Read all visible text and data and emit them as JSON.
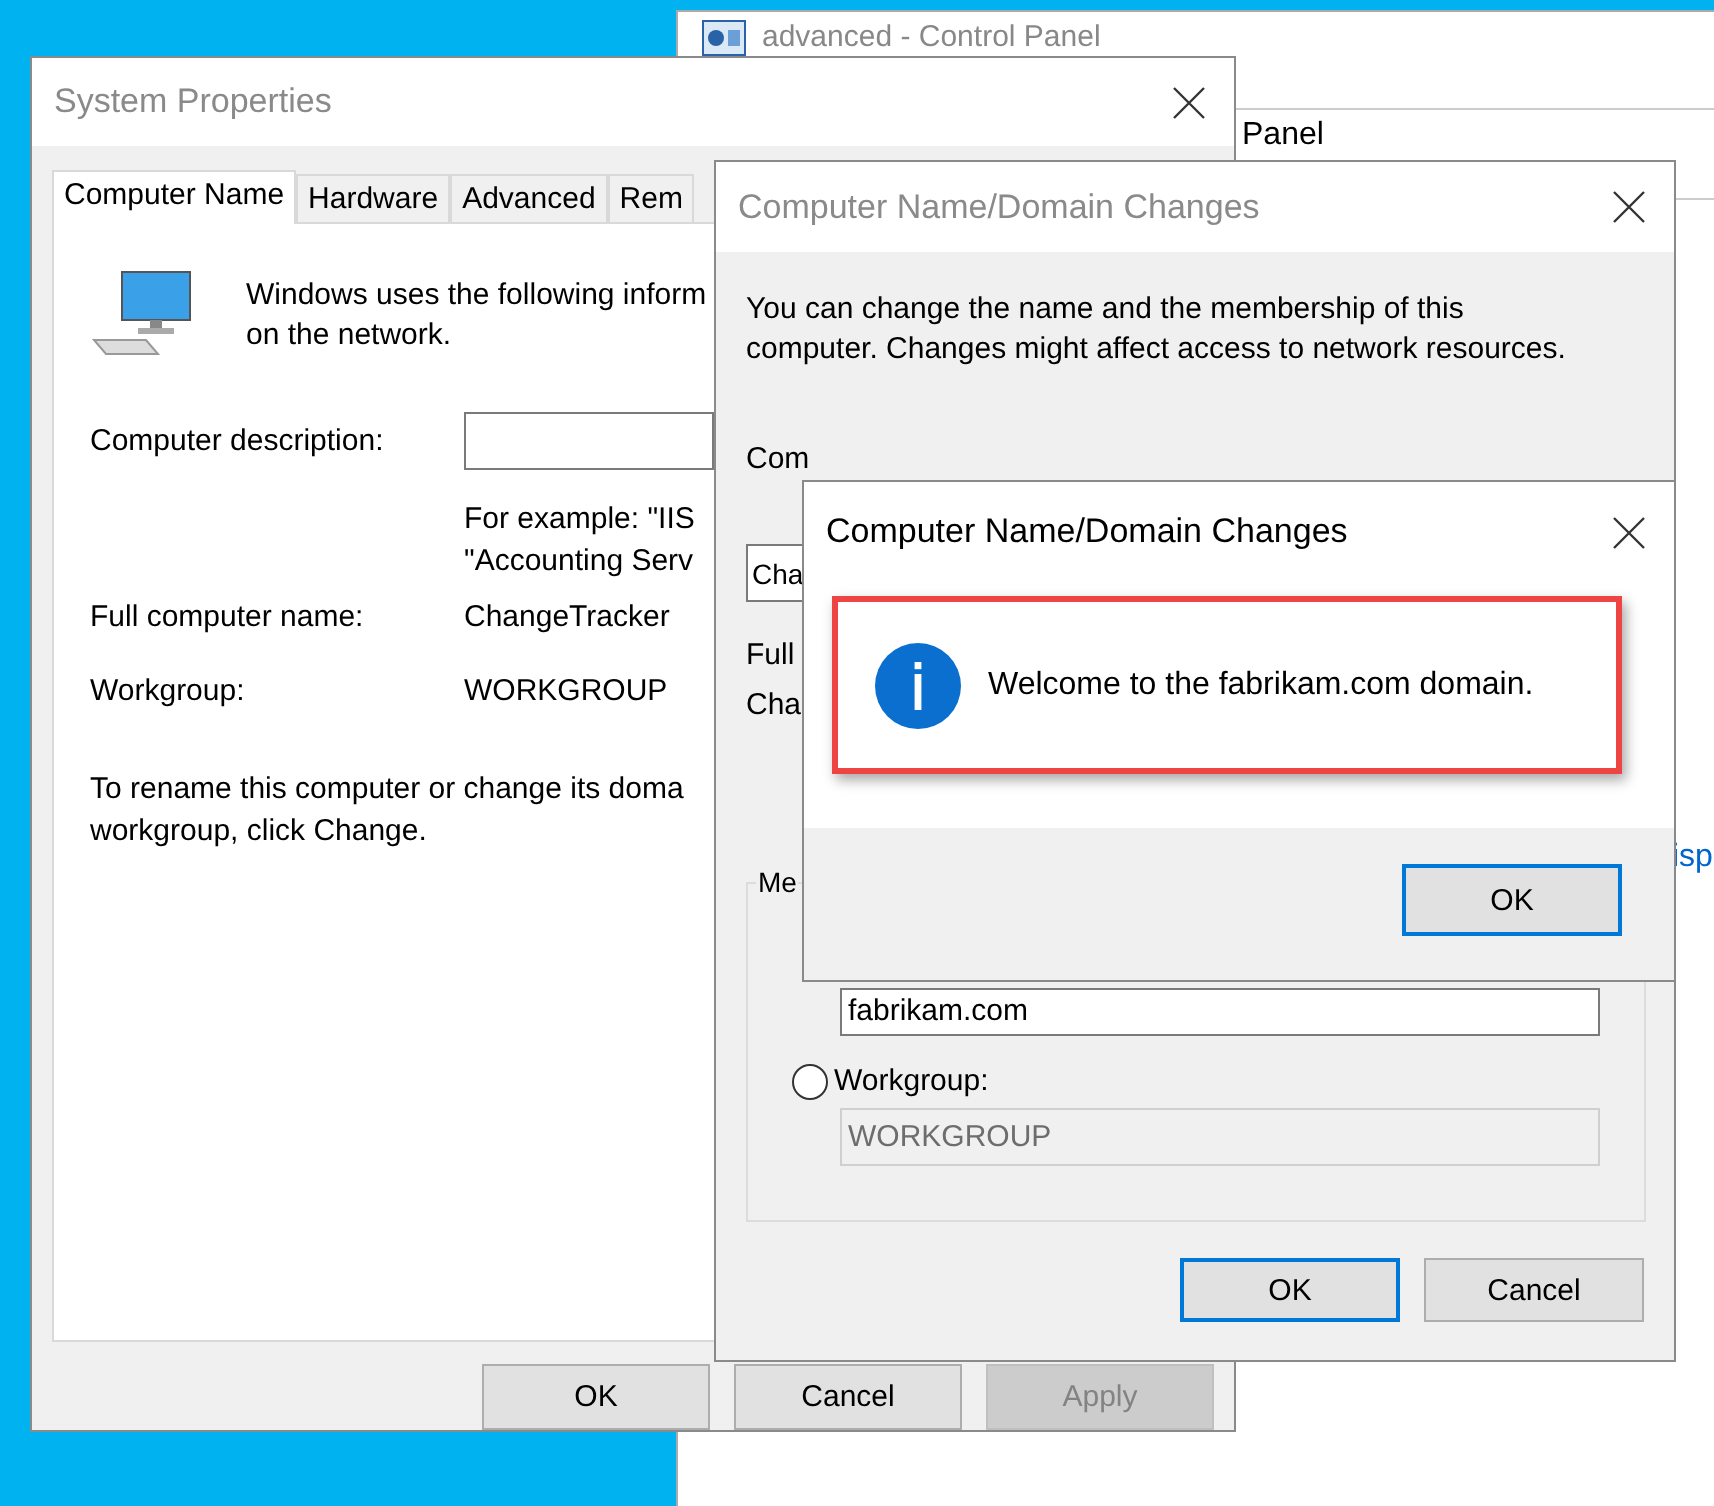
{
  "control_panel": {
    "title": "advanced - Control Panel",
    "breadcrumb": "Panel",
    "link": "isp"
  },
  "system_properties": {
    "title": "System Properties",
    "tabs": [
      {
        "label": "Computer Name",
        "selected": true
      },
      {
        "label": "Hardware",
        "selected": false
      },
      {
        "label": "Advanced",
        "selected": false
      },
      {
        "label": "Rem",
        "selected": false
      }
    ],
    "intro_lines": [
      "Windows uses the following inform",
      "on the network."
    ],
    "description_label": "Computer description:",
    "example_lines": [
      "For example: \"IIS",
      "\"Accounting Serv"
    ],
    "fields": [
      {
        "label": "Full computer name:",
        "value": "ChangeTracker"
      },
      {
        "label": "Workgroup:",
        "value": "WORKGROUP"
      }
    ],
    "rename_lines": [
      "To rename this computer or change its doma",
      "workgroup, click Change."
    ],
    "buttons": [
      {
        "label": "OK",
        "disabled": false
      },
      {
        "label": "Cancel",
        "disabled": false
      },
      {
        "label": "Apply",
        "disabled": true
      }
    ]
  },
  "domain_dialog": {
    "title": "Computer Name/Domain Changes",
    "intro_lines": [
      "You can change the name and the membership of this",
      "computer. Changes might affect access to network resources."
    ],
    "computer_name_label": "Com",
    "computer_name_value": "Cha",
    "full_name_label": "Full",
    "full_name_value": "Cha",
    "member_label": "Me",
    "options": [
      {
        "value": "fabrikam.com",
        "disabled": false
      },
      {
        "label": "Workgroup:",
        "selected": false,
        "value": "WORKGROUP",
        "disabled": true
      }
    ],
    "buttons": [
      {
        "label": "OK",
        "default": true
      },
      {
        "label": "Cancel",
        "default": false
      }
    ]
  },
  "message_box": {
    "title": "Computer Name/Domain Changes",
    "message": "Welcome to the fabrikam.com domain.",
    "button": {
      "label": "OK",
      "default": true
    }
  }
}
